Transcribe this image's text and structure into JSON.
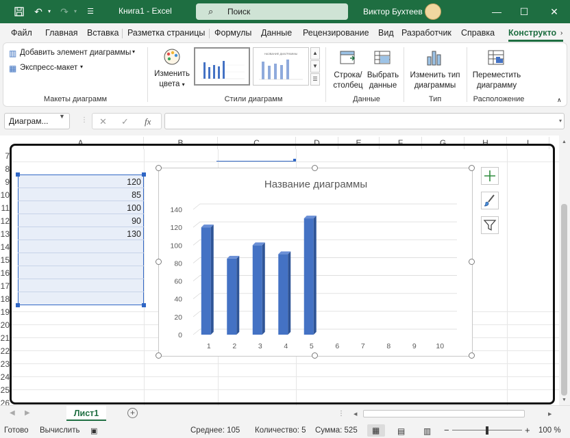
{
  "titlebar": {
    "doc_title": "Книга1  -  Excel",
    "search_label": "Поиск",
    "user_name": "Виктор Бухтеев"
  },
  "tabs": [
    "Файл",
    "Главная",
    "Вставка",
    "Разметка страницы",
    "Формулы",
    "Данные",
    "Рецензирование",
    "Вид",
    "Разработчик",
    "Справка",
    "Конструкто"
  ],
  "ribbon": {
    "add_element": "Добавить элемент диаграммы",
    "express_layout": "Экспресс-макет",
    "change_colors_l1": "Изменить",
    "change_colors_l2": "цвета",
    "thumb2_title": "НАЗВАНИЕ ДИАГРАММЫ",
    "row_col_l1": "Строка/",
    "row_col_l2": "столбец",
    "select_data_l1": "Выбрать",
    "select_data_l2": "данные",
    "change_type_l1": "Изменить тип",
    "change_type_l2": "диаграммы",
    "move_chart_l1": "Переместить",
    "move_chart_l2": "диаграмму",
    "groups": [
      "Макеты диаграмм",
      "Стили диаграмм",
      "Данные",
      "Тип",
      "Расположение"
    ]
  },
  "formula_bar": {
    "name_box": "Диаграм...",
    "fx": "fx"
  },
  "grid": {
    "columns": [
      "A",
      "B",
      "C",
      "D",
      "E",
      "F",
      "G",
      "H",
      "I"
    ],
    "rows": [
      "7",
      "8",
      "9",
      "10",
      "11",
      "12",
      "13",
      "14",
      "15",
      "16",
      "17",
      "18",
      "19",
      "20",
      "21",
      "22",
      "23",
      "24",
      "25",
      "26"
    ],
    "values": [
      "120",
      "85",
      "100",
      "90",
      "130"
    ]
  },
  "chart_data": {
    "type": "bar",
    "title": "Название диаграммы",
    "categories": [
      "1",
      "2",
      "3",
      "4",
      "5",
      "6",
      "7",
      "8",
      "9",
      "10"
    ],
    "values": [
      120,
      85,
      100,
      90,
      130,
      null,
      null,
      null,
      null,
      null
    ],
    "ylim": [
      0,
      140
    ],
    "yticks": [
      "0",
      "20",
      "40",
      "60",
      "80",
      "100",
      "120",
      "140"
    ],
    "color": "#4472c4",
    "grid": true,
    "xlabel": "",
    "ylabel": ""
  },
  "sheet": {
    "tab_name": "Лист1"
  },
  "status": {
    "ready": "Готово",
    "calculate": "Вычислить",
    "average": "Среднее: 105",
    "count": "Количество: 5",
    "sum": "Сумма: 525",
    "zoom": "100 %"
  }
}
